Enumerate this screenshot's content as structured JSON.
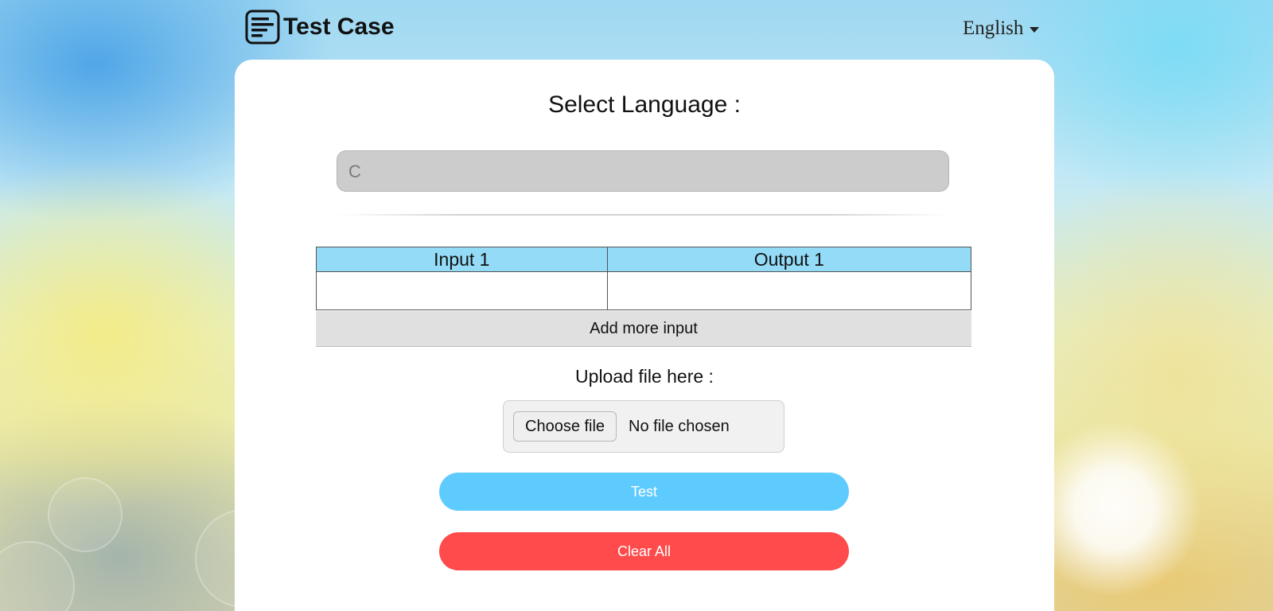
{
  "header": {
    "title": "Test Case",
    "brand_icon": "document-lines-icon",
    "language_label": "English"
  },
  "main": {
    "heading": "Select Language :",
    "language_value": "C",
    "table": {
      "headers": [
        "Input 1",
        "Output 1"
      ]
    },
    "add_more_label": "Add more input",
    "upload": {
      "label": "Upload file here :",
      "choose_button": "Choose file",
      "status": "No file chosen"
    },
    "test_button": "Test",
    "clear_button": "Clear All"
  },
  "colors": {
    "table_header": "#93dbf6",
    "test_button": "#5ecbff",
    "clear_button": "#ff4b4b",
    "select_bg": "#cccccc"
  }
}
